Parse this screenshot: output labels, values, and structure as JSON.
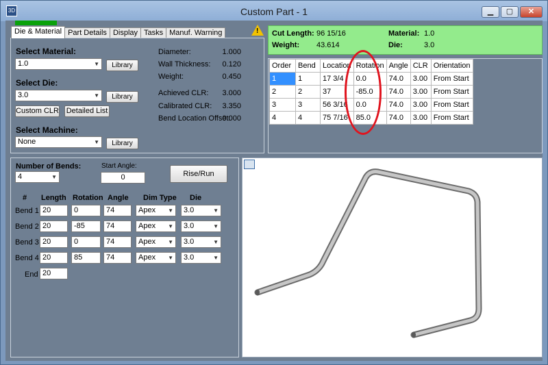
{
  "window": {
    "title": "Custom Part - 1",
    "app_icon": "app-icon",
    "min_label": "▁",
    "max_label": "▢",
    "close_label": "✕"
  },
  "tabs": [
    "Die & Material",
    "Part Details",
    "Display",
    "Tasks",
    "Manuf. Warning"
  ],
  "die_material": {
    "select_material_label": "Select Material:",
    "material_value": "1.0",
    "library_label": "Library",
    "select_die_label": "Select Die:",
    "die_value": "3.0",
    "custom_clr_label": "Custom CLR",
    "detailed_list_label": "Detailed List",
    "select_machine_label": "Select Machine:",
    "machine_value": "None",
    "props": [
      {
        "label": "Diameter:",
        "value": "1.000"
      },
      {
        "label": "Wall Thickness:",
        "value": "0.120"
      },
      {
        "label": "Weight:",
        "value": "0.450"
      },
      {
        "label": "Achieved CLR:",
        "value": "3.000"
      },
      {
        "label": "Calibrated CLR:",
        "value": "3.350"
      },
      {
        "label": "Bend Location Offset:",
        "value": "0.000"
      }
    ]
  },
  "summary": {
    "cut_length_label": "Cut Length:",
    "cut_length_value": "96 15/16",
    "weight_label": "Weight:",
    "weight_value": "43.614",
    "material_label": "Material:",
    "material_value": "1.0",
    "die_label": "Die:",
    "die_value": "3.0"
  },
  "bend_table": {
    "headers": [
      "Order",
      "Bend",
      "Location",
      "Rotation",
      "Angle",
      "CLR",
      "Orientation"
    ],
    "rows": [
      [
        "1",
        "1",
        "17 3/4",
        "0.0",
        "74.0",
        "3.00",
        "From Start"
      ],
      [
        "2",
        "2",
        "37",
        "-85.0",
        "74.0",
        "3.00",
        "From Start"
      ],
      [
        "3",
        "3",
        "56 3/16",
        "0.0",
        "74.0",
        "3.00",
        "From Start"
      ],
      [
        "4",
        "4",
        "75 7/16",
        "85.0",
        "74.0",
        "3.00",
        "From Start"
      ]
    ]
  },
  "bends_editor": {
    "number_of_bends_label": "Number of Bends:",
    "number_of_bends_value": "4",
    "start_angle_label": "Start Angle:",
    "start_angle_value": "0",
    "rise_run_label": "Rise/Run",
    "col_headers": [
      "#",
      "Length",
      "Rotation",
      "Angle",
      "Dim Type",
      "Die"
    ],
    "rows": [
      {
        "label": "Bend 1",
        "length": "20",
        "rotation": "0",
        "angle": "74",
        "dim_type": "Apex",
        "die": "3.0"
      },
      {
        "label": "Bend 2",
        "length": "20",
        "rotation": "-85",
        "angle": "74",
        "dim_type": "Apex",
        "die": "3.0"
      },
      {
        "label": "Bend 3",
        "length": "20",
        "rotation": "0",
        "angle": "74",
        "dim_type": "Apex",
        "die": "3.0"
      },
      {
        "label": "Bend 4",
        "length": "20",
        "rotation": "85",
        "angle": "74",
        "dim_type": "Apex",
        "die": "3.0"
      }
    ],
    "end_label": "End",
    "end_value": "20"
  },
  "view": {
    "icon": "view-options-icon"
  },
  "colors": {
    "summary_bg": "#93eb8c",
    "progress": "#0aa10a",
    "highlight_oval": "#e0141e",
    "selected_cell": "#3390ff"
  }
}
